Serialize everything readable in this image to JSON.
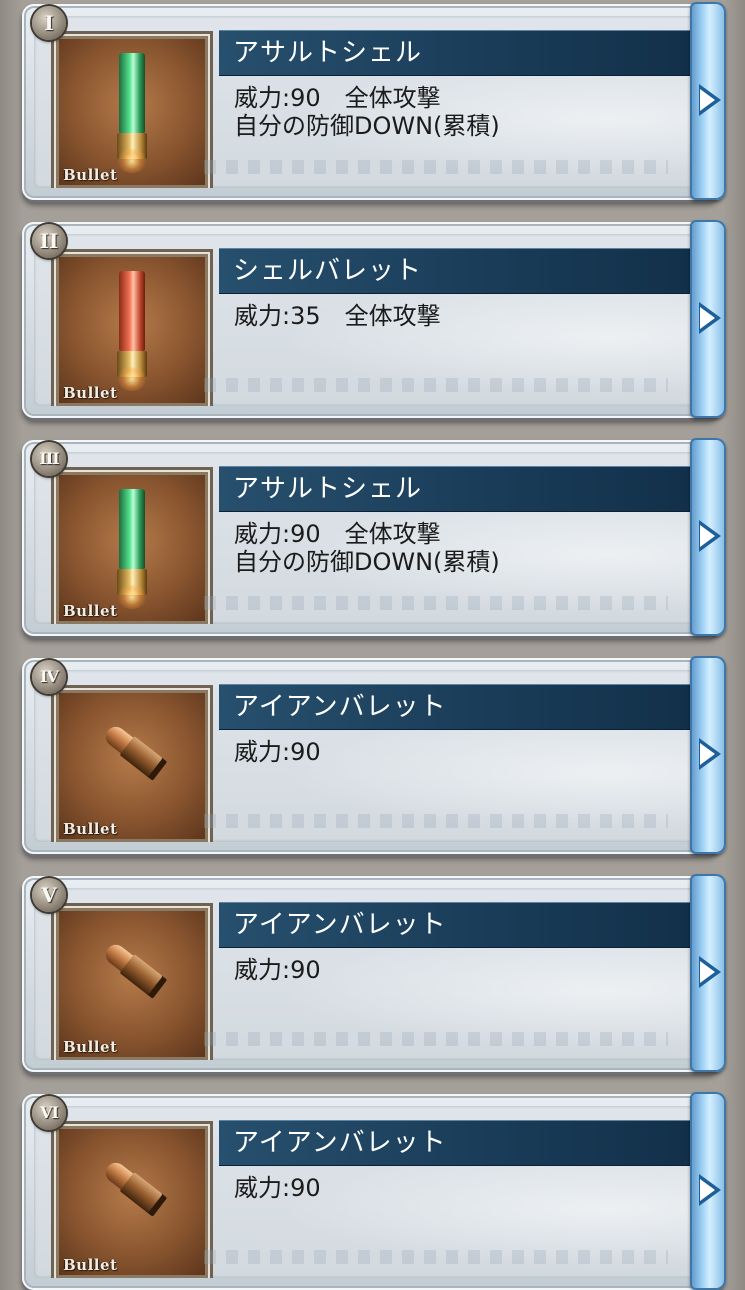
{
  "bullet_list": {
    "items": [
      {
        "numeral": "I",
        "name": "アサルトシェル",
        "power_line": "威力:90　全体攻撃",
        "effect_line": "自分の防御DOWN(累積)",
        "type_label": "Bullet",
        "icon": "green-shell-icon",
        "icon_color": "#3cc97a"
      },
      {
        "numeral": "II",
        "name": "シェルバレット",
        "power_line": "威力:35　全体攻撃",
        "effect_line": "",
        "type_label": "Bullet",
        "icon": "red-shell-icon",
        "icon_color": "#e8603c"
      },
      {
        "numeral": "III",
        "name": "アサルトシェル",
        "power_line": "威力:90　全体攻撃",
        "effect_line": "自分の防御DOWN(累積)",
        "type_label": "Bullet",
        "icon": "green-shell-icon",
        "icon_color": "#3cc97a"
      },
      {
        "numeral": "IV",
        "name": "アイアンバレット",
        "power_line": "威力:90",
        "effect_line": "",
        "type_label": "Bullet",
        "icon": "iron-bullet-icon",
        "icon_color": "#a8683a"
      },
      {
        "numeral": "V",
        "name": "アイアンバレット",
        "power_line": "威力:90",
        "effect_line": "",
        "type_label": "Bullet",
        "icon": "iron-bullet-icon",
        "icon_color": "#a8683a"
      },
      {
        "numeral": "VI",
        "name": "アイアンバレット",
        "power_line": "威力:90",
        "effect_line": "",
        "type_label": "Bullet",
        "icon": "iron-bullet-icon",
        "icon_color": "#a8683a"
      }
    ],
    "arrow_icon": "chevron-right-icon"
  },
  "theme": {
    "title_bar_color": "#1a3d59",
    "panel_color": "#d6dde3",
    "arrow_color": "#7fb8e3"
  }
}
